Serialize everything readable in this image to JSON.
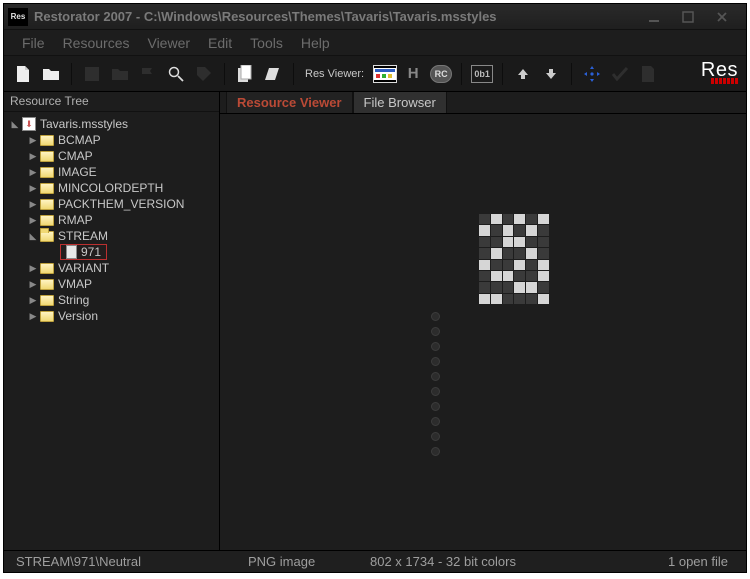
{
  "window": {
    "title": "Restorator 2007 - C:\\Windows\\Resources\\Themes\\Tavaris\\Tavaris.msstyles"
  },
  "menu": {
    "file": "File",
    "resources": "Resources",
    "viewer": "Viewer",
    "edit": "Edit",
    "tools": "Tools",
    "help": "Help"
  },
  "toolbar": {
    "resviewer_label": "Res Viewer:",
    "logo": "Res"
  },
  "tree": {
    "header": "Resource Tree",
    "root": "Tavaris.msstyles",
    "items": [
      {
        "label": "BCMAP",
        "expanded": false
      },
      {
        "label": "CMAP",
        "expanded": false
      },
      {
        "label": "IMAGE",
        "expanded": false
      },
      {
        "label": "MINCOLORDEPTH",
        "expanded": false
      },
      {
        "label": "PACKTHEM_VERSION",
        "expanded": false
      },
      {
        "label": "RMAP",
        "expanded": false
      },
      {
        "label": "STREAM",
        "expanded": true,
        "children": [
          {
            "label": "971",
            "selected": true
          }
        ]
      },
      {
        "label": "VARIANT",
        "expanded": false
      },
      {
        "label": "VMAP",
        "expanded": false
      },
      {
        "label": "String",
        "expanded": false
      },
      {
        "label": "Version",
        "expanded": false
      }
    ]
  },
  "tabs": {
    "viewer": "Resource Viewer",
    "browser": "File Browser"
  },
  "status": {
    "path": "STREAM\\971\\Neutral",
    "type": "PNG image",
    "dim": "802 x 1734 - 32 bit colors",
    "open": "1 open file"
  }
}
